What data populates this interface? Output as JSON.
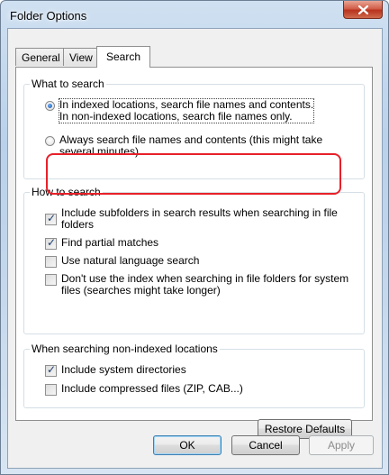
{
  "window": {
    "title": "Folder Options",
    "close_glyph": "X"
  },
  "tabs": [
    {
      "label": "General"
    },
    {
      "label": "View"
    },
    {
      "label": "Search",
      "active": true
    }
  ],
  "what_to_search": {
    "title": "What to search",
    "option1_line1": "In indexed locations, search file names and contents.",
    "option1_line2": "In non-indexed locations, search file names only.",
    "option1_checked": true,
    "option2_line1": "Always search file names and contents (this might take",
    "option2_line2": "several minutes)",
    "option2_checked": false
  },
  "how_to_search": {
    "title": "How to search",
    "items": [
      {
        "line1": "Include subfolders in search results when searching in file",
        "line2": "folders",
        "checked": true
      },
      {
        "line1": "Find partial matches",
        "checked": true
      },
      {
        "line1": "Use natural language search",
        "checked": false
      },
      {
        "line1": "Don't use the index when searching in file folders for system",
        "line2": "files (searches might take longer)",
        "checked": false
      }
    ]
  },
  "non_indexed": {
    "title": "When searching non-indexed locations",
    "items": [
      {
        "line1": "Include system directories",
        "checked": true
      },
      {
        "line1": "Include compressed files (ZIP, CAB...)",
        "checked": false
      }
    ]
  },
  "buttons": {
    "restore_defaults": "Restore Defaults",
    "ok": "OK",
    "cancel": "Cancel",
    "apply": "Apply"
  },
  "colors": {
    "highlight": "#e8202a",
    "close_button": "#c6452c"
  }
}
